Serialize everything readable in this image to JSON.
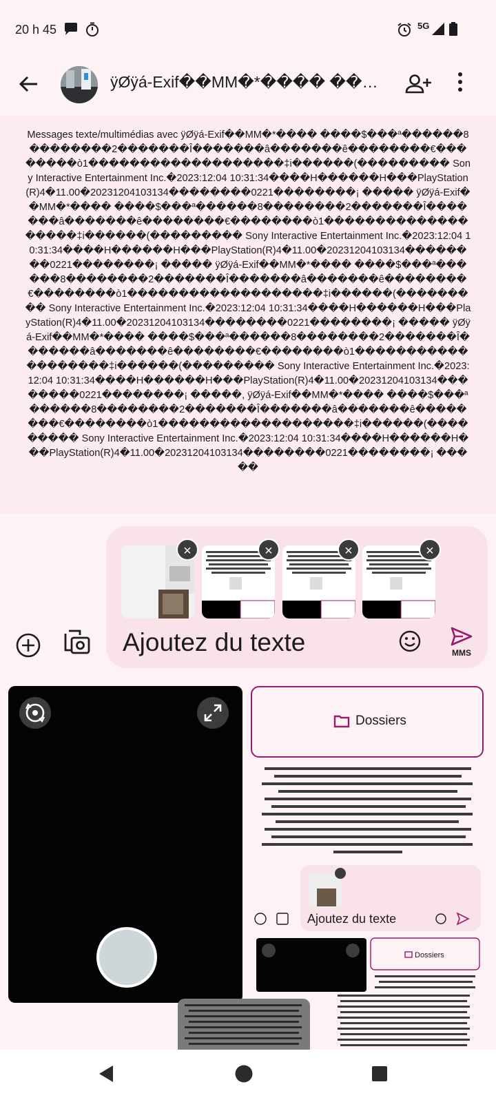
{
  "status_bar": {
    "time": "20 h 45",
    "network": "5G"
  },
  "app_bar": {
    "title": "ÿØÿá-Exif��MM�*���� ���..."
  },
  "conversation": {
    "info": "Messages texte/multimédias avec ÿØÿá-Exif��MM�*���� ����$���ª������8��������2�������Î�������â�������ê��������€��������ò1�������������������‡i������(��������� Sony Interactive Entertainment Inc.�2023:12:04 10:31:34����H������H���PlayStation(R)4�11.00�20231204103134��������0221��������¡ ����� ÿØÿá-Exif��MM�*���� ����$���ª������8��������2�������Î�������â�������ê��������€��������ò1�������������������‡i������(��������� Sony Interactive Entertainment Inc.�2023:12:04 10:31:34����H������H���PlayStation(R)4�11.00�20231204103134��������0221��������¡ ����� ÿØÿá-Exif��MM�*���� ����$���ª������8��������2�������Î�������â�������ê��������€��������ò1�������������������‡i������(��������� Sony Interactive Entertainment Inc.�2023:12:04 10:31:34����H������H���PlayStation(R)4�11.00�20231204103134��������0221��������¡ ����� ÿØÿá-Exif��MM�*���� ����$���ª������8��������2�������Î�������â�������ê��������€��������ò1�������������������‡i������(��������� Sony Interactive Entertainment Inc.�2023:12:04 10:31:34����H������H���PlayStation(R)4�11.00�20231204103134��������0221��������¡ �����, ÿØÿá-Exif��MM�*���� ����$���ª������8��������2�������Î�������â�������ê��������€��������ò1�������������������‡i������(��������� Sony Interactive Entertainment Inc.�2023:12:04 10:31:34����H������H���PlayStation(R)4�11.00�20231204103134��������0221��������¡ �����"
  },
  "compose": {
    "placeholder": "Ajoutez du texte",
    "send_label": "MMS",
    "attachment_count": 4
  },
  "media_picker": {
    "folders_label": "Dossiers"
  },
  "colors": {
    "accent": "#9c1a6d",
    "background": "#fdf2f4",
    "compose_bg": "#f9e3e8"
  }
}
